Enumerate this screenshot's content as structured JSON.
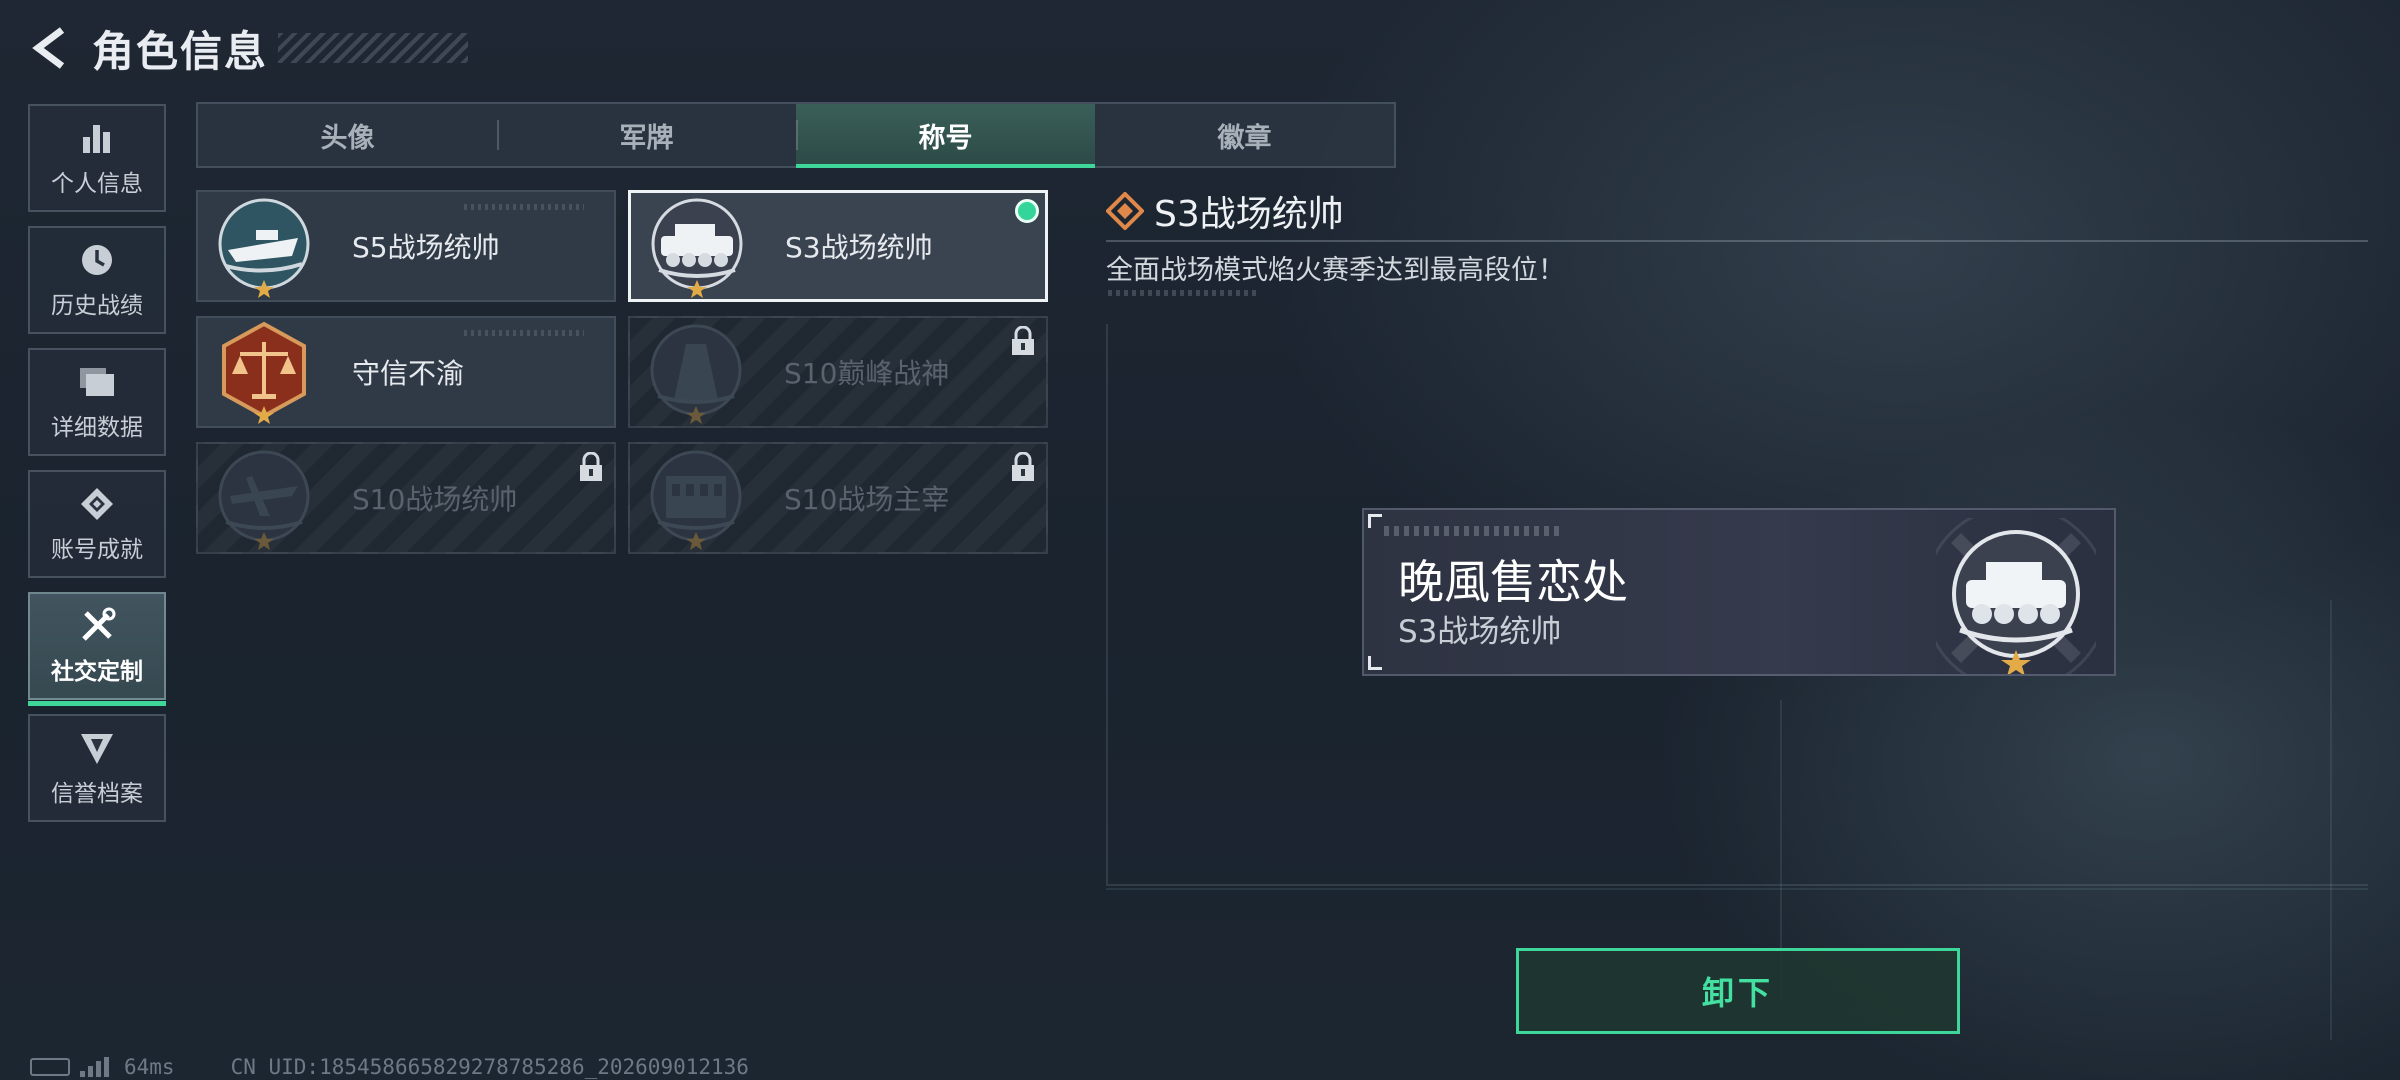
{
  "header": {
    "title": "角色信息"
  },
  "sidebar": {
    "items": [
      {
        "label": "个人信息",
        "icon": "bar-chart-icon",
        "active": false
      },
      {
        "label": "历史战绩",
        "icon": "clock-icon",
        "active": false
      },
      {
        "label": "详细数据",
        "icon": "folder-icon",
        "active": false
      },
      {
        "label": "账号成就",
        "icon": "achievement-icon",
        "active": false
      },
      {
        "label": "社交定制",
        "icon": "tools-icon",
        "active": true
      },
      {
        "label": "信誉档案",
        "icon": "credit-shield-icon",
        "active": false
      }
    ]
  },
  "tabs": [
    {
      "label": "头像",
      "active": false
    },
    {
      "label": "军牌",
      "active": false
    },
    {
      "label": "称号",
      "active": true
    },
    {
      "label": "徽章",
      "active": false
    }
  ],
  "titles": [
    {
      "name": "S5战场统帅",
      "badge": "speedboat-badge-icon",
      "locked": false,
      "selected": false,
      "equipped": false
    },
    {
      "name": "S3战场统帅",
      "badge": "tank-badge-icon",
      "locked": false,
      "selected": true,
      "equipped": true
    },
    {
      "name": "守信不渝",
      "badge": "scales-badge-icon",
      "locked": false,
      "selected": false,
      "equipped": false
    },
    {
      "name": "S10巅峰战神",
      "badge": "tower-badge-icon",
      "locked": true,
      "selected": false,
      "equipped": false
    },
    {
      "name": "S10战场统帅",
      "badge": "plane-badge-icon",
      "locked": true,
      "selected": false,
      "equipped": false
    },
    {
      "name": "S10战场主宰",
      "badge": "colosseum-badge-icon",
      "locked": true,
      "selected": false,
      "equipped": false
    }
  ],
  "detail": {
    "title": "S3战场统帅",
    "description": "全面战场模式焰火赛季达到最高段位！"
  },
  "preview": {
    "nickname": "晚風售恋处",
    "title": "S3战场统帅"
  },
  "action": {
    "unequip_label": "卸下"
  },
  "status": {
    "ping": "64ms",
    "uid": "CN UID:18545866582927878528​6_202609012136"
  },
  "colors": {
    "accent": "#3fd69a",
    "background": "#1b2430",
    "diamond": "#e0874a"
  }
}
